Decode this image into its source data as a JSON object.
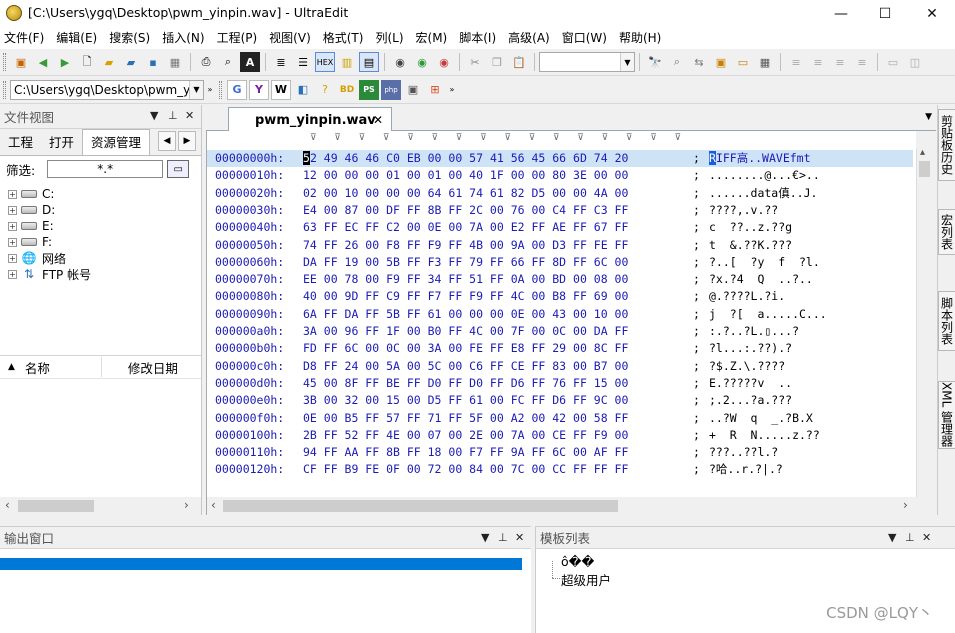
{
  "window": {
    "title": "[C:\\Users\\ygq\\Desktop\\pwm_yinpin.wav] - UltraEdit",
    "minimize": "—",
    "maximize": "☐",
    "close": "✕"
  },
  "menu": [
    "文件(F)",
    "编辑(E)",
    "搜索(S)",
    "插入(N)",
    "工程(P)",
    "视图(V)",
    "格式(T)",
    "列(L)",
    "宏(M)",
    "脚本(I)",
    "高级(A)",
    "窗口(W)",
    "帮助(H)"
  ],
  "toolbar2": {
    "path_value": "C:\\Users\\ygq\\Desktop\\pwm_yi"
  },
  "file_view": {
    "title": "文件视图",
    "tabs": [
      "工程",
      "打开",
      "资源管理"
    ],
    "filter_label": "筛选:",
    "filter_value": "*.*",
    "tree": [
      "C:",
      "D:",
      "E:",
      "F:",
      "网络",
      "FTP 帐号"
    ],
    "columns": [
      "名称",
      "修改日期"
    ]
  },
  "editor": {
    "tab_label": "pwm_yinpin.wav",
    "rows": [
      {
        "addr": "00000000h:",
        "bytes": "2 49 46 46 C0 EB 00 00 57 41 56 45 66 6D 74 20",
        "first": "5",
        "ascii_first": "R",
        "ascii": "IFF高..WAVEfmt "
      },
      {
        "addr": "00000010h:",
        "bytes": "12 00 00 00 01 00 01 00 40 1F 00 00 80 3E 00 00",
        "ascii": "........@...€>.."
      },
      {
        "addr": "00000020h:",
        "bytes": "02 00 10 00 00 00 64 61 74 61 82 D5 00 00 4A 00",
        "ascii": "......data傎..J."
      },
      {
        "addr": "00000030h:",
        "bytes": "E4 00 87 00 DF FF 8B FF 2C 00 76 00 C4 FF C3 FF",
        "ascii": "????,.v.??"
      },
      {
        "addr": "00000040h:",
        "bytes": "63 FF EC FF C2 00 0E 00 7A 00 E2 FF AE FF 67 FF",
        "ascii": "c  ??..z.??g"
      },
      {
        "addr": "00000050h:",
        "bytes": "74 FF 26 00 F8 FF F9 FF 4B 00 9A 00 D3 FF FE FF",
        "ascii": "t  &.??K.???"
      },
      {
        "addr": "00000060h:",
        "bytes": "DA FF 19 00 5B FF F3 FF 79 FF 66 FF 8D FF 6C 00",
        "ascii": "?..[  ?y  f  ?l."
      },
      {
        "addr": "00000070h:",
        "bytes": "EE 00 78 00 F9 FF 34 FF 51 FF 0A 00 BD 00 08 00",
        "ascii": "?x.?4  Q  ..?.."
      },
      {
        "addr": "00000080h:",
        "bytes": "40 00 9D FF C9 FF F7 FF F9 FF 4C 00 B8 FF 69 00",
        "ascii": "@.????L.?i."
      },
      {
        "addr": "00000090h:",
        "bytes": "6A FF DA FF 5B FF 61 00 00 00 0E 00 43 00 10 00",
        "ascii": "j  ?[  a.....C..."
      },
      {
        "addr": "000000a0h:",
        "bytes": "3A 00 96 FF 1F 00 B0 FF 4C 00 7F 00 0C 00 DA FF",
        "ascii": ":.?..?L.▯...?"
      },
      {
        "addr": "000000b0h:",
        "bytes": "FD FF 6C 00 0C 00 3A 00 FE FF E8 FF 29 00 8C FF",
        "ascii": "?l...:.??).?"
      },
      {
        "addr": "000000c0h:",
        "bytes": "D8 FF 24 00 5A 00 5C 00 C6 FF CE FF 83 00 B7 00",
        "ascii": "?$.Z.\\.????"
      },
      {
        "addr": "000000d0h:",
        "bytes": "45 00 8F FF BE FF D0 FF D0 FF D6 FF 76 FF 15 00",
        "ascii": "E.?????v  .."
      },
      {
        "addr": "000000e0h:",
        "bytes": "3B 00 32 00 15 00 D5 FF 61 00 FC FF D6 FF 9C 00",
        "ascii": ";.2...?a.???"
      },
      {
        "addr": "000000f0h:",
        "bytes": "0E 00 B5 FF 57 FF 71 FF 5F 00 A2 00 42 00 58 FF",
        "ascii": "..?W  q  _.?B.X"
      },
      {
        "addr": "00000100h:",
        "bytes": "2B FF 52 FF 4E 00 07 00 2E 00 7A 00 CE FF F9 00",
        "ascii": "+  R  N.....z.??"
      },
      {
        "addr": "00000110h:",
        "bytes": "94 FF AA FF 8B FF 18 00 F7 FF 9A FF 6C 00 AF FF",
        "ascii": "???..??l.?"
      },
      {
        "addr": "00000120h:",
        "bytes": "CF FF B9 FE 0F 00 72 00 84 00 7C 00 CC FF FF FF",
        "ascii": "?哈..r.?|.?"
      }
    ]
  },
  "side_tabs": [
    "剪贴板历史",
    "宏列表",
    "脚本列表",
    "XML 管理器"
  ],
  "output_panel": {
    "title": "输出窗口"
  },
  "template_panel": {
    "title": "模板列表",
    "items": [
      "ô��",
      "超级用户"
    ]
  },
  "watermark": "CSDN @LQY丶"
}
